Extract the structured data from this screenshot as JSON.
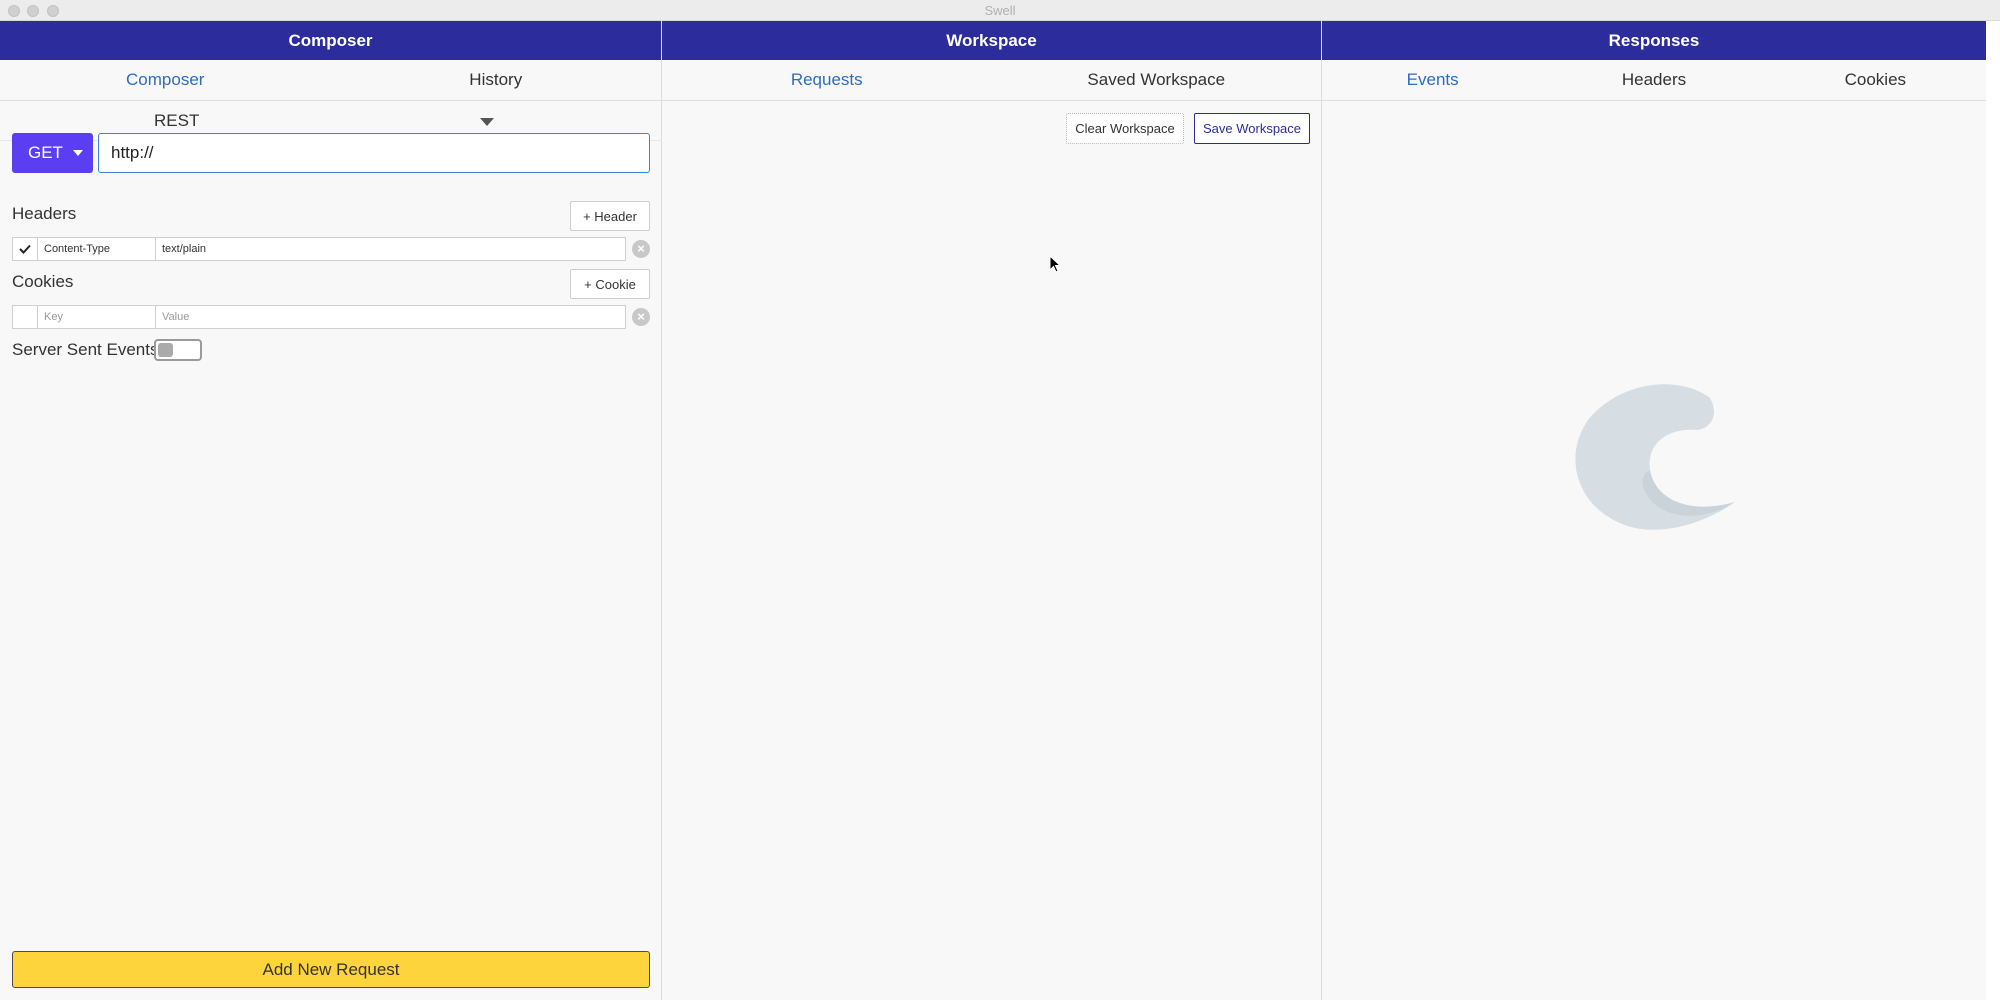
{
  "window": {
    "title": "Swell"
  },
  "composer": {
    "header": "Composer",
    "tabs": [
      {
        "label": "Composer",
        "active": true
      },
      {
        "label": "History",
        "active": false
      }
    ],
    "protocol": "REST",
    "method": "GET",
    "url_value": "http://",
    "headers_label": "Headers",
    "add_header_label": "+ Header",
    "headers": [
      {
        "checked": true,
        "key": "Content-Type",
        "value": "text/plain"
      }
    ],
    "cookies_label": "Cookies",
    "add_cookie_label": "+ Cookie",
    "cookie_key_placeholder": "Key",
    "cookie_value_placeholder": "Value",
    "sse_label": "Server Sent Events",
    "sse_enabled": false,
    "add_request_label": "Add New Request"
  },
  "workspace": {
    "header": "Workspace",
    "tabs": [
      {
        "label": "Requests",
        "active": true
      },
      {
        "label": "Saved Workspace",
        "active": false
      }
    ],
    "clear_label": "Clear Workspace",
    "save_label": "Save Workspace"
  },
  "responses": {
    "header": "Responses",
    "tabs": [
      {
        "label": "Events",
        "active": true
      },
      {
        "label": "Headers",
        "active": false
      },
      {
        "label": "Cookies",
        "active": false
      }
    ]
  },
  "colors": {
    "header_bg": "#2c2c9c",
    "active_tab": "#2e6bc2",
    "method_bg": "#5c3ef2",
    "add_request_bg": "#fed43c"
  },
  "icons": {
    "dropdown": "caret-down-icon",
    "check": "check-icon",
    "delete": "close-circle-icon",
    "logo": "swell-logo"
  }
}
